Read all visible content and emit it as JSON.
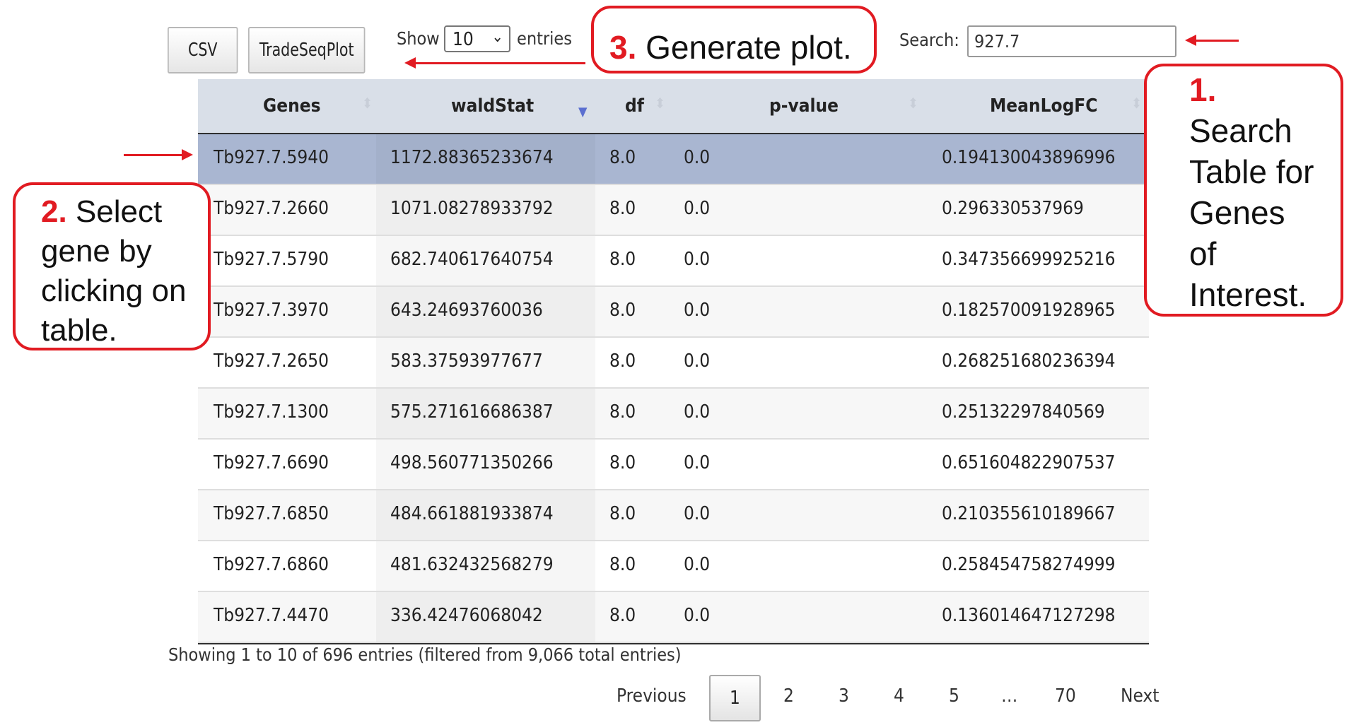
{
  "toolbar": {
    "csv_label": "CSV",
    "tradeseq_label": "TradeSeqPlot",
    "show_label": "Show",
    "entries_value": "10",
    "entries_label": "entries",
    "search_label": "Search:",
    "search_value": "927.7"
  },
  "table": {
    "columns": [
      "Genes",
      "waldStat",
      "df",
      "p-value",
      "MeanLogFC"
    ],
    "rows": [
      [
        "Tb927.7.5940",
        "1172.88365233674",
        "8.0",
        "0.0",
        "0.194130043896996"
      ],
      [
        "Tb927.7.2660",
        "1071.08278933792",
        "8.0",
        "0.0",
        "0.296330537969"
      ],
      [
        "Tb927.7.5790",
        "682.740617640754",
        "8.0",
        "0.0",
        "0.347356699925216"
      ],
      [
        "Tb927.7.3970",
        "643.24693760036",
        "8.0",
        "0.0",
        "0.182570091928965"
      ],
      [
        "Tb927.7.2650",
        "583.37593977677",
        "8.0",
        "0.0",
        "0.268251680236394"
      ],
      [
        "Tb927.7.1300",
        "575.271616686387",
        "8.0",
        "0.0",
        "0.25132297840569"
      ],
      [
        "Tb927.7.6690",
        "498.560771350266",
        "8.0",
        "0.0",
        "0.651604822907537"
      ],
      [
        "Tb927.7.6850",
        "484.661881933874",
        "8.0",
        "0.0",
        "0.210355610189667"
      ],
      [
        "Tb927.7.6860",
        "481.632432568279",
        "8.0",
        "0.0",
        "0.258454758274999"
      ],
      [
        "Tb927.7.4470",
        "336.42476068042",
        "8.0",
        "0.0",
        "0.136014647127298"
      ]
    ],
    "selected_row": 0
  },
  "info": "Showing 1 to 10 of 696 entries (filtered from 9,066 total entries)",
  "pagination": {
    "previous": "Previous",
    "pages": [
      "1",
      "2",
      "3",
      "4",
      "5",
      "…",
      "70"
    ],
    "current": "1",
    "next": "Next"
  },
  "annotations": {
    "step1_num": "1.",
    "step1_text": [
      "Search",
      "Table for",
      "Genes",
      "of",
      "Interest."
    ],
    "step2_num": "2.",
    "step2_text_first": "Select",
    "step2_text_rest": [
      "gene by",
      "clicking on",
      "table."
    ],
    "step3_num": "3.",
    "step3_text": "Generate plot.",
    "accent_color": "#e11b22"
  }
}
